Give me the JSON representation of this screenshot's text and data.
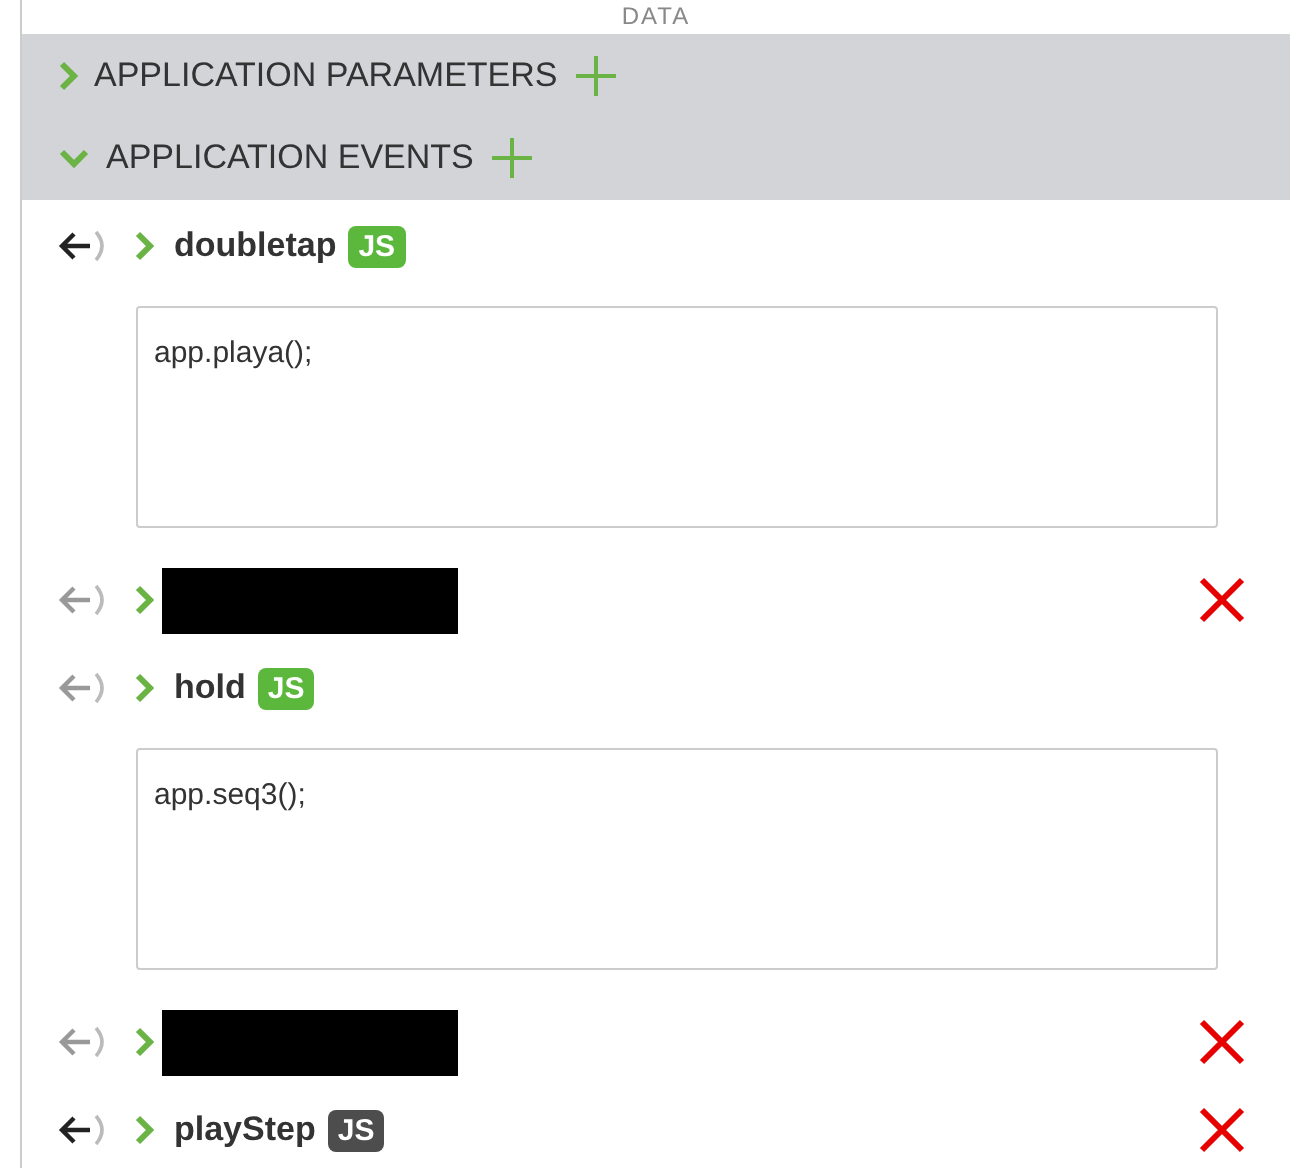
{
  "header": {
    "title": "DATA"
  },
  "sections": [
    {
      "label": "APPLICATION PARAMETERS",
      "expanded": false
    },
    {
      "label": "APPLICATION EVENTS",
      "expanded": true
    }
  ],
  "events": [
    {
      "kind": "event",
      "name": "doubletap",
      "linked": true,
      "badge": "JS",
      "badge_active": true,
      "deletable": false,
      "code": "app.playa();"
    },
    {
      "kind": "redacted",
      "linked": false,
      "deletable": true
    },
    {
      "kind": "event",
      "name": "hold",
      "linked": false,
      "badge": "JS",
      "badge_active": true,
      "deletable": false,
      "code": "app.seq3();"
    },
    {
      "kind": "redacted",
      "linked": false,
      "deletable": true
    },
    {
      "kind": "event",
      "name": "playStep",
      "linked": true,
      "badge": "JS",
      "badge_active": false,
      "deletable": true
    }
  ]
}
